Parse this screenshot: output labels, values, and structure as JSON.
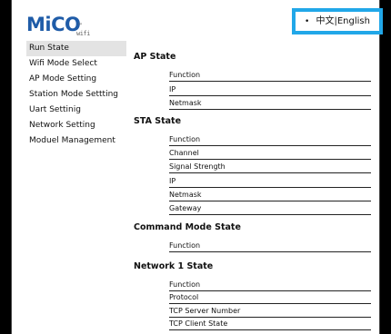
{
  "logo": {
    "brand": "MiCO",
    "tm": "™",
    "sub": "wifi"
  },
  "language": {
    "label": "中文|English"
  },
  "sidebar": {
    "items": [
      {
        "label": "Run State",
        "active": true
      },
      {
        "label": "Wifi Mode Select"
      },
      {
        "label": "AP Mode Setting"
      },
      {
        "label": "Station Mode Settting"
      },
      {
        "label": "Uart Settinig"
      },
      {
        "label": "Network Setting"
      },
      {
        "label": "Moduel Management"
      }
    ]
  },
  "sections": {
    "ap": {
      "title": "AP State",
      "fields": [
        "Function",
        "IP",
        "Netmask"
      ]
    },
    "sta": {
      "title": "STA State",
      "fields": [
        "Function",
        "Channel",
        "Signal Strength",
        "IP",
        "Netmask",
        "Gateway"
      ]
    },
    "command": {
      "title": "Command Mode State",
      "fields": [
        "Function"
      ]
    },
    "network1": {
      "title": "Network 1 State",
      "fields": [
        "Function",
        "Protocol",
        "TCP Server Number",
        "TCP Client State"
      ]
    }
  }
}
